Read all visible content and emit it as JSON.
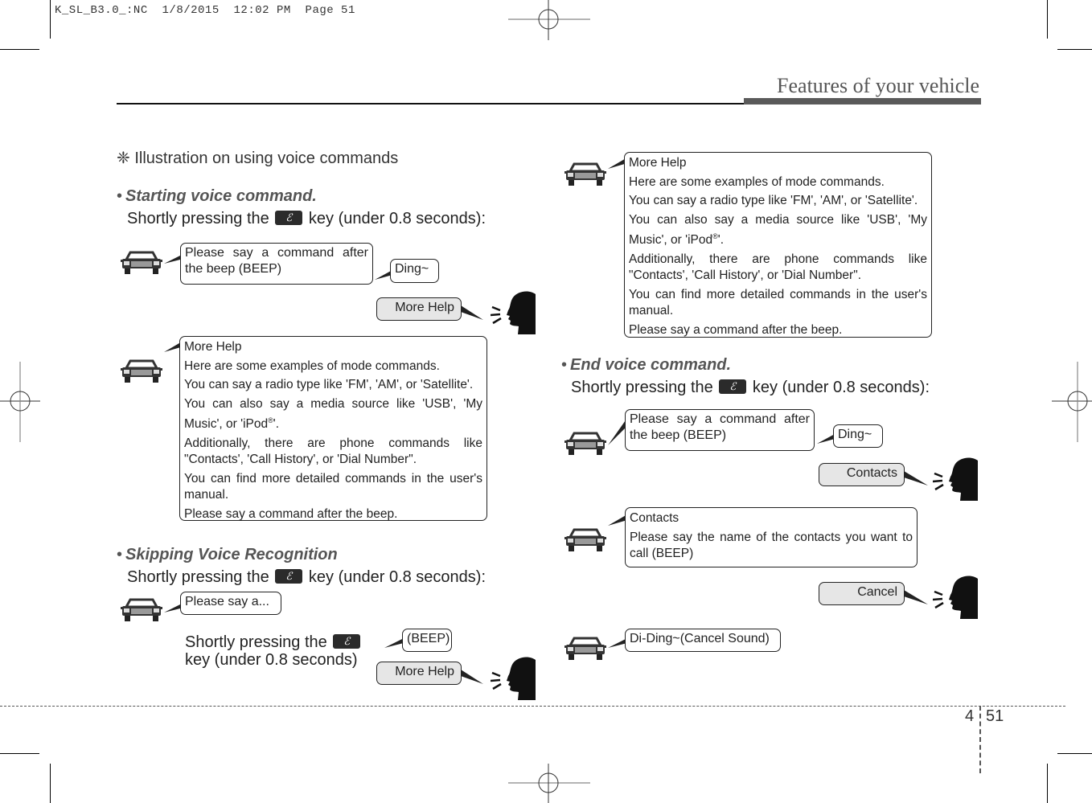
{
  "slug": "K_SL_B3.0_:NC  1/8/2015  12:02 PM  Page 51",
  "header": {
    "title": "Features of your vehicle"
  },
  "intro": "❈ Illustration on using voice commands",
  "key_icon": "voice-key-icon",
  "sections": {
    "starting": {
      "title": "Starting voice command.",
      "instr_pre": "Shortly pressing the",
      "instr_post": "key (under 0.8 seconds):",
      "sys_prompt": "Please say a command after the beep (BEEP)",
      "ding": "Ding~",
      "user_more_help": "More Help",
      "help_title": "More Help",
      "help_lines": [
        "Here are some examples of mode commands.",
        "You can say a radio type like 'FM', 'AM', or 'Satellite'.",
        "You can also say a media source like 'USB', 'My Music', or 'iPod",
        "'.",
        "Additionally, there are phone commands like \"Contacts', 'Call History', or 'Dial Number\".",
        "You can find more detailed commands in the user's manual.",
        "Please say a command after the beep."
      ],
      "reg_mark": "®"
    },
    "skipping": {
      "title": "Skipping Voice Recognition",
      "instr_pre": "Shortly pressing the",
      "instr_post": "key (under 0.8 seconds):",
      "sys_prompt": "Please say a...",
      "inner_pre": "Shortly pressing the",
      "inner_post": "key (under 0.8 seconds)",
      "beep": "(BEEP)",
      "user_more_help": "More Help"
    },
    "end": {
      "title": "End voice command.",
      "instr_pre": "Shortly pressing the",
      "instr_post": "key (under 0.8 seconds):",
      "sys_prompt": "Please say a command after the beep (BEEP)",
      "ding": "Ding~",
      "user_contacts": "Contacts",
      "contacts_title": "Contacts",
      "contacts_body": "Please say the name of the contacts you want to call (BEEP)",
      "user_cancel": "Cancel",
      "cancel_sound": "Di-Ding~(Cancel Sound)"
    }
  },
  "footer": {
    "chapter": "4",
    "page": "51"
  },
  "colors": {
    "section_heading": "#555555",
    "user_bubble": "#e6e6e6",
    "header_bar": "#5a5a5a"
  }
}
